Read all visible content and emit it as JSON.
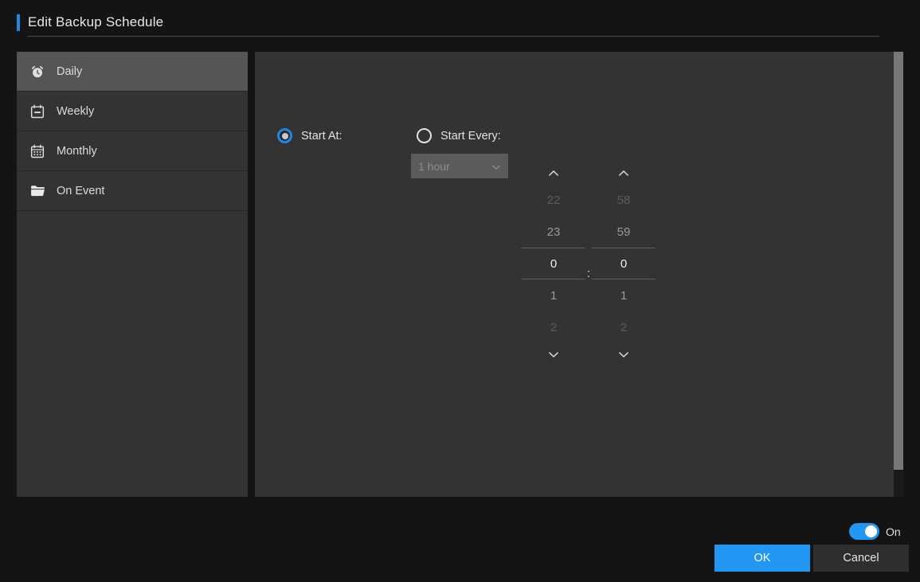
{
  "header": {
    "title": "Edit Backup Schedule",
    "accent_color": "#1e88e5"
  },
  "sidebar": {
    "items": [
      {
        "label": "Daily",
        "icon": "alarm-clock-icon",
        "selected": true
      },
      {
        "label": "Weekly",
        "icon": "calendar-week-icon",
        "selected": false
      },
      {
        "label": "Monthly",
        "icon": "calendar-month-icon",
        "selected": false
      },
      {
        "label": "On Event",
        "icon": "folder-icon",
        "selected": false
      }
    ]
  },
  "main": {
    "start_at": {
      "label": "Start At:",
      "selected": true,
      "hours": {
        "values": [
          "22",
          "23",
          "0",
          "1",
          "2"
        ],
        "selected": "0",
        "up_arrow": "chevron-up-icon",
        "down_arrow": "chevron-down-icon"
      },
      "separator": ":",
      "minutes": {
        "values": [
          "58",
          "59",
          "0",
          "1",
          "2"
        ],
        "selected": "0",
        "up_arrow": "chevron-up-icon",
        "down_arrow": "chevron-down-icon"
      }
    },
    "start_every": {
      "label": "Start Every:",
      "selected": false,
      "dropdown": {
        "value": "1 hour",
        "disabled": true,
        "chevron": "chevron-down-icon"
      }
    }
  },
  "footer": {
    "toggle": {
      "state": "on",
      "label": "On",
      "color": "#2196f3"
    },
    "ok_label": "OK",
    "cancel_label": "Cancel"
  }
}
